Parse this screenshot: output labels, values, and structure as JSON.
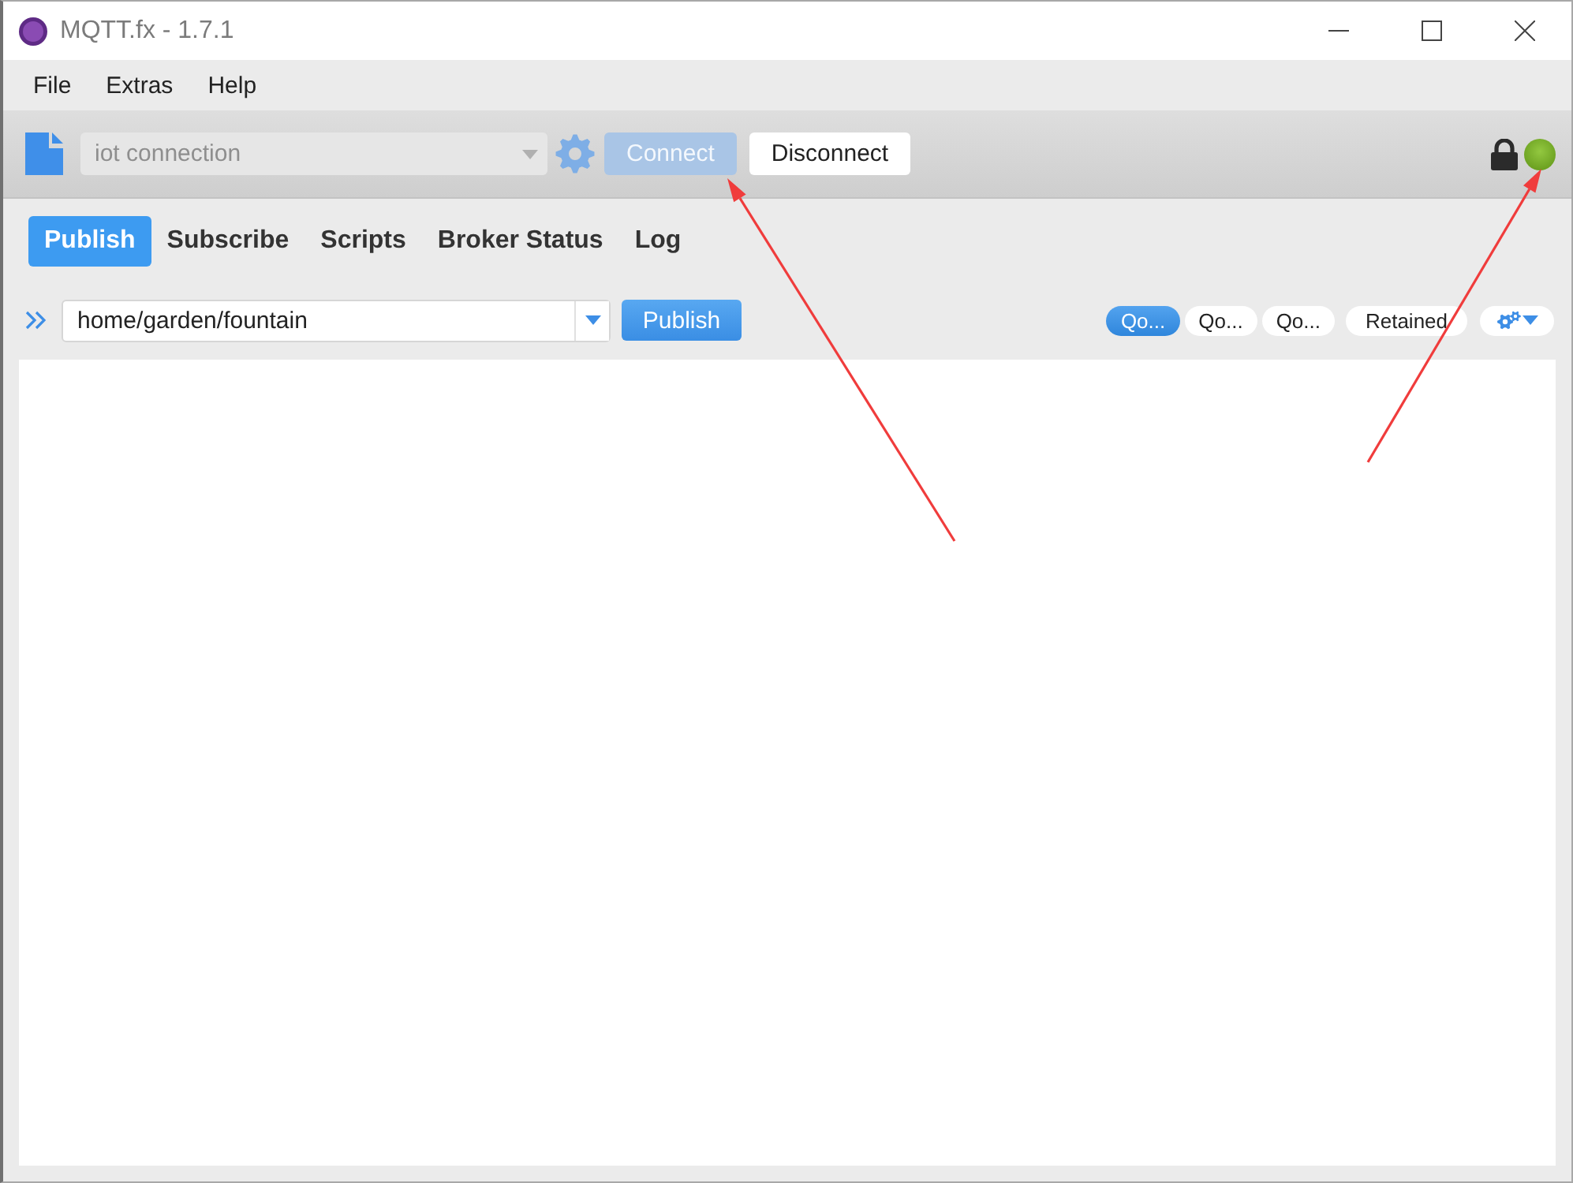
{
  "window": {
    "title": "MQTT.fx - 1.7.1"
  },
  "menu": [
    "File",
    "Extras",
    "Help"
  ],
  "toolbar": {
    "connection_profile": {
      "value": "iot connection",
      "disabled": true
    },
    "connect_button": {
      "label": "Connect",
      "disabled": true,
      "marked_by_arrow": true
    },
    "disconnect_button": {
      "label": "Disconnect",
      "disabled": false
    },
    "connection_status": {
      "connected": true,
      "marked_by_arrow": true
    }
  },
  "tabs": [
    {
      "label": "Publish",
      "selected": true
    },
    {
      "label": "Subscribe",
      "selected": false
    },
    {
      "label": "Scripts",
      "selected": false
    },
    {
      "label": "Broker Status",
      "selected": false
    },
    {
      "label": "Log",
      "selected": false
    }
  ],
  "publish": {
    "topic": {
      "value": "home/garden/fountain"
    },
    "publish_button": {
      "label": "Publish"
    },
    "qos_buttons": [
      {
        "label": "Qo...",
        "selected": true
      },
      {
        "label": "Qo...",
        "selected": false
      },
      {
        "label": "Qo...",
        "selected": false
      }
    ],
    "retained_button": {
      "label": "Retained",
      "selected": false
    }
  }
}
